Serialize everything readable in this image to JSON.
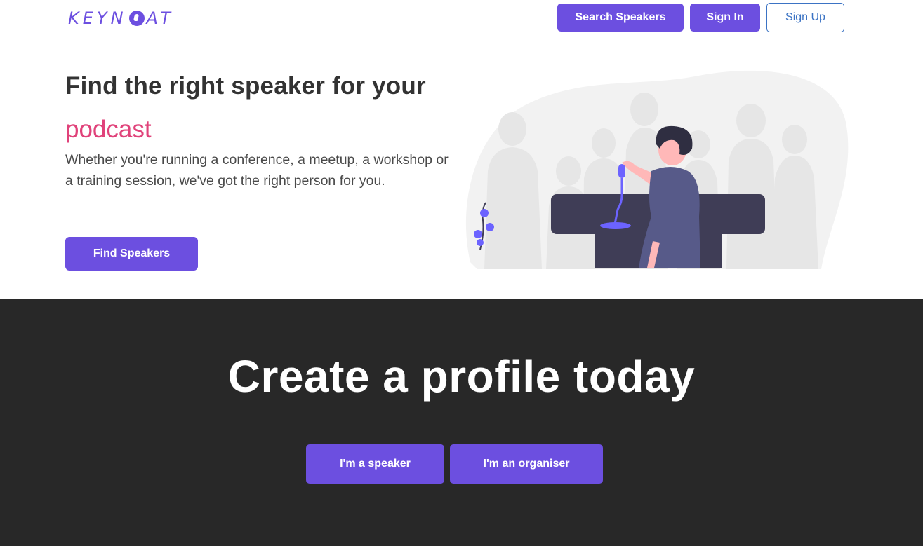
{
  "header": {
    "logo_text_left": "KEYN",
    "logo_text_right": "AT",
    "search_label": "Search Speakers",
    "signin_label": "Sign In",
    "signup_label": "Sign Up"
  },
  "hero": {
    "title": "Find the right speaker for your",
    "rotating_word": "podcast",
    "description": "Whether you're running a conference, a meetup, a workshop or a training session, we've got the right person for you.",
    "cta_label": "Find Speakers"
  },
  "cta": {
    "title": "Create a profile today",
    "speaker_label": "I'm a speaker",
    "organiser_label": "I'm an organiser"
  },
  "colors": {
    "brand": "#6c4fe0",
    "accent_word": "#e0427a",
    "dark_section": "#282828",
    "signup_outline": "#3b73c4"
  }
}
